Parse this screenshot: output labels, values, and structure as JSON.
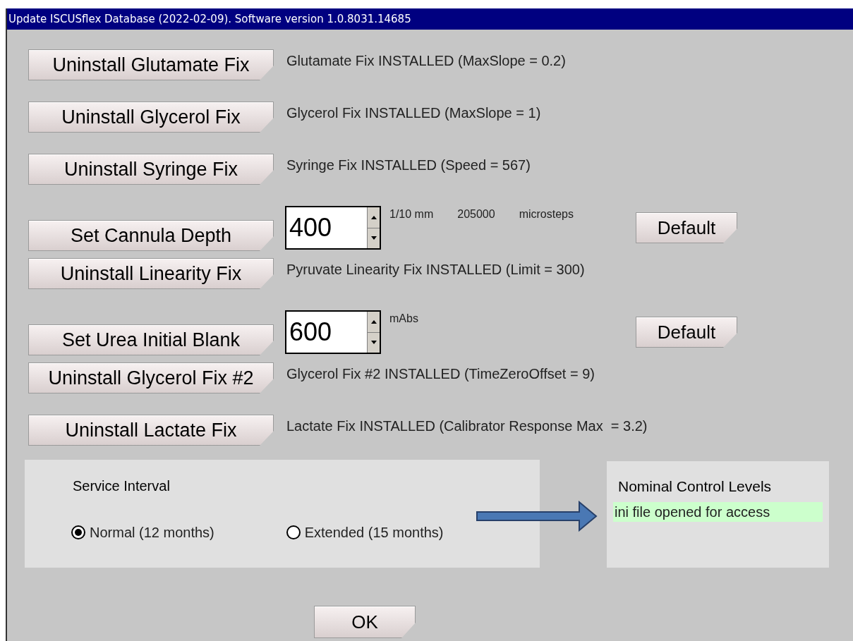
{
  "window": {
    "title": "Update ISCUSflex Database (2022-02-09). Software version 1.0.8031.14685"
  },
  "rows": [
    {
      "kind": "status",
      "button": "Uninstall Glutamate Fix",
      "status": "Glutamate Fix INSTALLED (MaxSlope = 0.2)"
    },
    {
      "kind": "status",
      "button": "Uninstall Glycerol Fix",
      "status": "Glycerol Fix INSTALLED (MaxSlope = 1)"
    },
    {
      "kind": "status",
      "button": "Uninstall Syringe Fix",
      "status": "Syringe Fix INSTALLED (Speed = 567)"
    },
    {
      "kind": "spinner",
      "button": "Set Cannula Depth",
      "value": "400",
      "units": [
        "1/10 mm",
        "205000",
        "microsteps"
      ],
      "default_button": "Default"
    },
    {
      "kind": "status",
      "button": "Uninstall Linearity Fix",
      "status": "Pyruvate Linearity Fix INSTALLED (Limit = 300)"
    },
    {
      "kind": "spinner",
      "button": "Set Urea Initial Blank",
      "value": "600",
      "units": [
        "mAbs"
      ],
      "default_button": "Default"
    },
    {
      "kind": "status",
      "button": "Uninstall Glycerol Fix #2",
      "status": "Glycerol Fix #2 INSTALLED (TimeZeroOffset = 9)"
    },
    {
      "kind": "status",
      "button": "Uninstall Lactate Fix",
      "status": "Lactate Fix INSTALLED (Calibrator Response Max  = 3.2)"
    }
  ],
  "service_interval": {
    "title": "Service Interval",
    "options": [
      {
        "label": "Normal (12 months)",
        "selected": true
      },
      {
        "label": "Extended (15 months)",
        "selected": false
      }
    ]
  },
  "nominal_control_levels": {
    "title": "Nominal Control Levels",
    "message": "ini file opened for access"
  },
  "ok_button": "OK"
}
